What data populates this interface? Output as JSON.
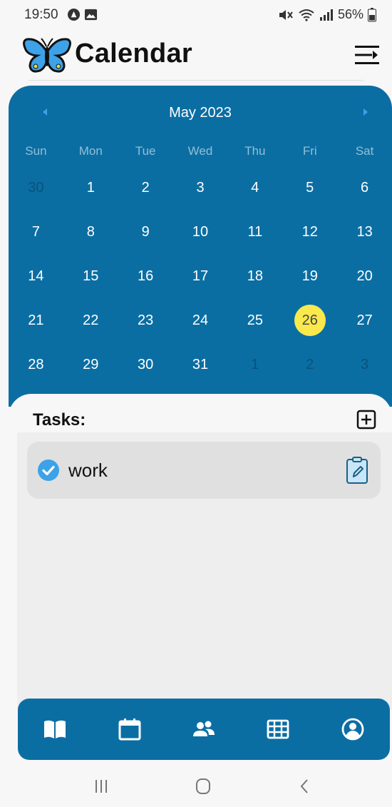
{
  "status_bar": {
    "time": "19:50",
    "battery": "56%",
    "icons": [
      "alert-circle-icon",
      "image-icon",
      "mute-icon",
      "wifi-icon",
      "signal-icon",
      "battery-icon"
    ]
  },
  "header": {
    "title": "Calendar",
    "logo": "butterfly-icon",
    "menu_icon": "menu-collapse-icon"
  },
  "calendar": {
    "month_label": "May 2023",
    "weekdays": [
      "Sun",
      "Mon",
      "Tue",
      "Wed",
      "Thu",
      "Fri",
      "Sat"
    ],
    "weeks": [
      [
        "30",
        "1",
        "2",
        "3",
        "4",
        "5",
        "6"
      ],
      [
        "7",
        "8",
        "9",
        "10",
        "11",
        "12",
        "13"
      ],
      [
        "14",
        "15",
        "16",
        "17",
        "18",
        "19",
        "20"
      ],
      [
        "21",
        "22",
        "23",
        "24",
        "25",
        "26",
        "27"
      ],
      [
        "28",
        "29",
        "30",
        "31",
        "1",
        "2",
        "3"
      ]
    ],
    "today": "26",
    "colors": {
      "background": "#0b6ea3",
      "today_highlight": "#f9e94d"
    }
  },
  "tasks": {
    "title": "Tasks:",
    "add_icon": "plus-square-icon",
    "items": [
      {
        "label": "work",
        "checked": true,
        "icon": "check-circle-icon",
        "action_icon": "clipboard-edit-icon"
      }
    ]
  },
  "bottom_nav": {
    "items": [
      "book-icon",
      "calendar-icon",
      "people-icon",
      "table-icon",
      "user-circle-icon"
    ]
  },
  "system_nav": {
    "items": [
      "recent-apps-icon",
      "home-icon",
      "back-icon"
    ]
  }
}
